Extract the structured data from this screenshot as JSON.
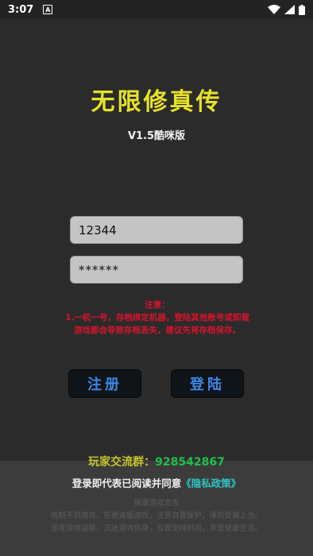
{
  "status_bar": {
    "time": "3:07",
    "notification_letter": "A"
  },
  "app": {
    "title": "无限修真传",
    "version": "V1.5酷咪版"
  },
  "login_form": {
    "account_value": "12344",
    "password_value": "******"
  },
  "notice": {
    "heading": "注意：",
    "body": "1.一机一号，存档绑定机器，登陆其他账号或卸载游戏都会导致存档丢失，建议先将存档保存。"
  },
  "buttons": {
    "register": "注册",
    "login": "登陆"
  },
  "community": {
    "label": "玩家交流群：",
    "number": "928542867"
  },
  "agreement": {
    "text": "登录即代表已阅读并同意",
    "link": "《隐私政策》"
  },
  "health_notice": {
    "title": "健康游戏忠告",
    "line1": "抵制不良游戏，拒绝盗版游戏，注意自我保护，谨防受骗上当。",
    "line2": "适度游戏益脑，沉迷游戏伤身，合理安排时间，享受健康生活。"
  },
  "colors": {
    "background": "#2b2b2b",
    "title": "#e5e22a",
    "notice": "#d6142c",
    "button_text": "#3f86e6",
    "qq_number": "#1fbf4a",
    "policy_link": "#2ec3c3"
  },
  "icons": [
    "notification-a-icon",
    "wifi-icon",
    "signal-icon",
    "battery-icon"
  ]
}
